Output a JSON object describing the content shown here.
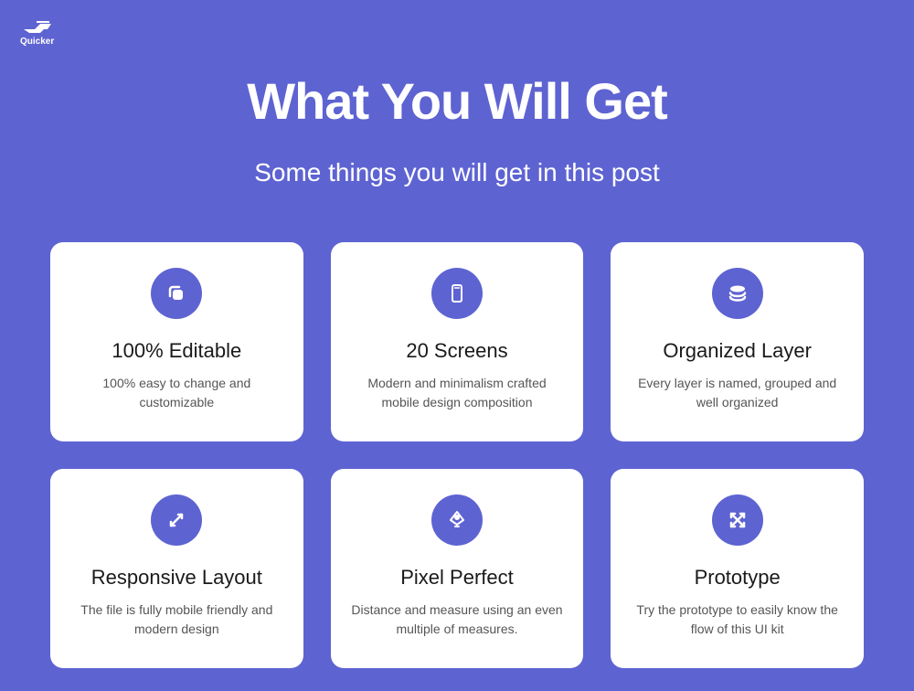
{
  "brand": {
    "name": "Quicker"
  },
  "header": {
    "title": "What You Will Get",
    "subtitle": "Some things you will get in this post"
  },
  "features": [
    {
      "icon": "copy",
      "title": "100% Editable",
      "desc": "100% easy to change and customizable"
    },
    {
      "icon": "mobile",
      "title": "20 Screens",
      "desc": "Modern and minimalism crafted mobile design composition"
    },
    {
      "icon": "layers",
      "title": "Organized Layer",
      "desc": "Every layer is named, grouped and well organized"
    },
    {
      "icon": "arrows",
      "title": "Responsive Layout",
      "desc": "The file is fully mobile friendly and modern design"
    },
    {
      "icon": "pixel",
      "title": "Pixel Perfect",
      "desc": "Distance and measure using an even multiple of measures."
    },
    {
      "icon": "prototype",
      "title": "Prototype",
      "desc": "Try the prototype to easily know the flow of this UI kit"
    }
  ]
}
